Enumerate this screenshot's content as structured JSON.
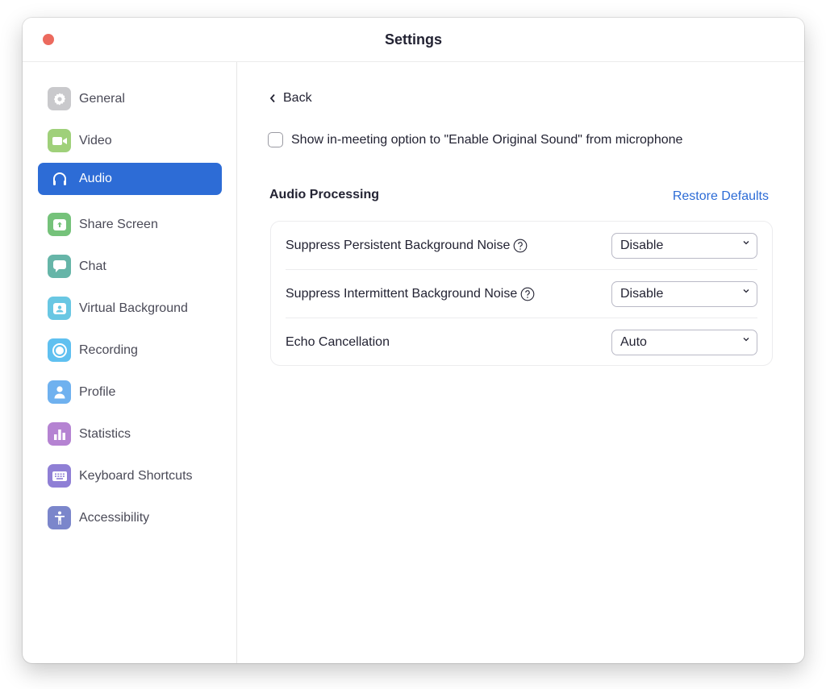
{
  "window": {
    "title": "Settings"
  },
  "sidebar": {
    "items": [
      {
        "id": "general",
        "label": "General",
        "icon": "gear-icon",
        "color": "#c9c9cc",
        "active": false
      },
      {
        "id": "video",
        "label": "Video",
        "icon": "video-camera-icon",
        "color": "#9fd07a",
        "active": false
      },
      {
        "id": "audio",
        "label": "Audio",
        "icon": "headphones-icon",
        "color": "#2d6cd6",
        "active": true
      },
      {
        "id": "share-screen",
        "label": "Share Screen",
        "icon": "share-screen-icon",
        "color": "#75c27a",
        "active": false
      },
      {
        "id": "chat",
        "label": "Chat",
        "icon": "chat-bubble-icon",
        "color": "#66b5a8",
        "active": false
      },
      {
        "id": "virtual-background",
        "label": "Virtual Background",
        "icon": "person-portrait-icon",
        "color": "#69c7e3",
        "active": false
      },
      {
        "id": "recording",
        "label": "Recording",
        "icon": "record-icon",
        "color": "#5fc0f0",
        "active": false
      },
      {
        "id": "profile",
        "label": "Profile",
        "icon": "user-icon",
        "color": "#6fb1ef",
        "active": false
      },
      {
        "id": "statistics",
        "label": "Statistics",
        "icon": "bar-chart-icon",
        "color": "#b583d2",
        "active": false
      },
      {
        "id": "keyboard-shortcuts",
        "label": "Keyboard Shortcuts",
        "icon": "keyboard-icon",
        "color": "#8f7fd5",
        "active": false
      },
      {
        "id": "accessibility",
        "label": "Accessibility",
        "icon": "accessibility-icon",
        "color": "#7b86cb",
        "active": false
      }
    ]
  },
  "main": {
    "back_label": "Back",
    "original_sound_checkbox": {
      "label": "Show in-meeting option to \"Enable Original Sound\" from microphone",
      "checked": false
    },
    "section_title": "Audio Processing",
    "restore_defaults_label": "Restore Defaults",
    "settings": [
      {
        "label": "Suppress Persistent Background Noise",
        "has_help": true,
        "value": "Disable"
      },
      {
        "label": "Suppress Intermittent Background Noise",
        "has_help": true,
        "value": "Disable"
      },
      {
        "label": "Echo Cancellation",
        "has_help": false,
        "value": "Auto"
      }
    ]
  },
  "colors": {
    "accent": "#2d6cd6",
    "close_button": "#ec6a5e"
  }
}
